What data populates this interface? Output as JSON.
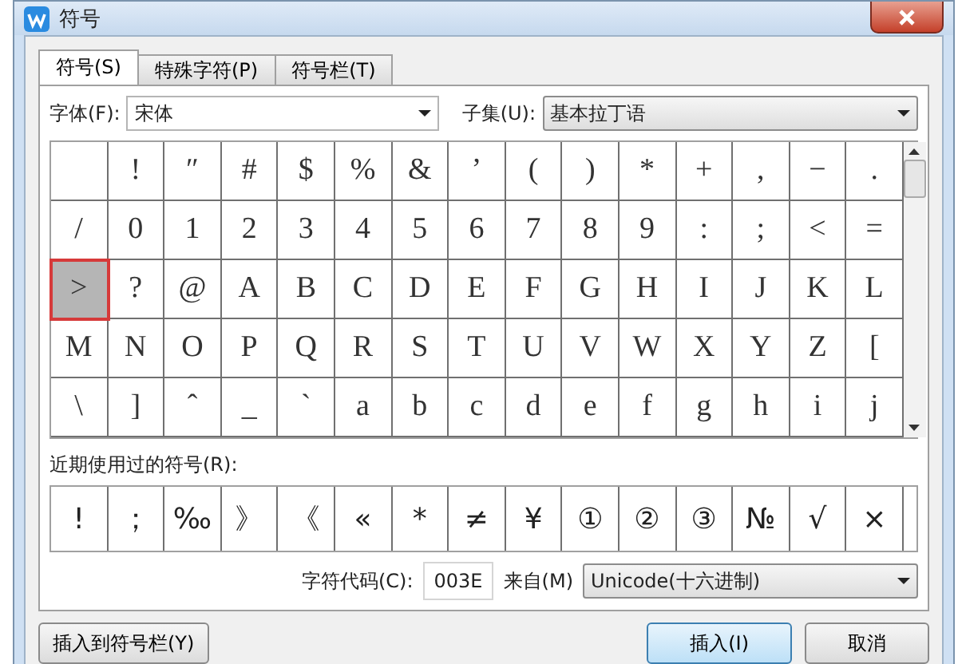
{
  "window": {
    "title": "符号"
  },
  "tabs": [
    {
      "label": "符号(S)",
      "selected": true
    },
    {
      "label": "特殊字符(P)",
      "selected": false
    },
    {
      "label": "符号栏(T)",
      "selected": false
    }
  ],
  "font": {
    "label": "字体(F):",
    "value": "宋体"
  },
  "subset": {
    "label": "子集(U):",
    "value": "基本拉丁语"
  },
  "grid": [
    [
      {
        "selected": false
      },
      {
        "char": "!",
        "selected": false
      },
      {
        "char": "″",
        "selected": false
      },
      {
        "char": "#",
        "selected": false
      },
      {
        "char": "$",
        "selected": false
      },
      {
        "char": "%",
        "selected": false
      },
      {
        "char": "&",
        "selected": false
      },
      {
        "char": "’",
        "selected": false
      },
      {
        "char": "(",
        "selected": false
      },
      {
        "char": ")",
        "selected": false
      },
      {
        "char": "*",
        "selected": false
      },
      {
        "char": "+",
        "selected": false
      },
      {
        "char": ",",
        "selected": false
      },
      {
        "char": "−",
        "selected": false
      },
      {
        "char": ".",
        "selected": false
      }
    ],
    [
      {
        "char": "/",
        "selected": false
      },
      {
        "char": "0",
        "selected": false
      },
      {
        "char": "1",
        "selected": false
      },
      {
        "char": "2",
        "selected": false
      },
      {
        "char": "3",
        "selected": false
      },
      {
        "char": "4",
        "selected": false
      },
      {
        "char": "5",
        "selected": false
      },
      {
        "char": "6",
        "selected": false
      },
      {
        "char": "7",
        "selected": false
      },
      {
        "char": "8",
        "selected": false
      },
      {
        "char": "9",
        "selected": false
      },
      {
        "char": ":",
        "selected": false
      },
      {
        "char": ";",
        "selected": false
      },
      {
        "char": "<",
        "selected": false
      },
      {
        "char": "=",
        "selected": false
      }
    ],
    [
      {
        "char": ">",
        "selected": true
      },
      {
        "char": "?",
        "selected": false
      },
      {
        "char": "@",
        "selected": false
      },
      {
        "char": "A",
        "selected": false
      },
      {
        "char": "B",
        "selected": false
      },
      {
        "char": "C",
        "selected": false
      },
      {
        "char": "D",
        "selected": false
      },
      {
        "char": "E",
        "selected": false
      },
      {
        "char": "F",
        "selected": false
      },
      {
        "char": "G",
        "selected": false
      },
      {
        "char": "H",
        "selected": false
      },
      {
        "char": "I",
        "selected": false
      },
      {
        "char": "J",
        "selected": false
      },
      {
        "char": "K",
        "selected": false
      },
      {
        "char": "L",
        "selected": false
      }
    ],
    [
      {
        "char": "M",
        "selected": false
      },
      {
        "char": "N",
        "selected": false
      },
      {
        "char": "O",
        "selected": false
      },
      {
        "char": "P",
        "selected": false
      },
      {
        "char": "Q",
        "selected": false
      },
      {
        "char": "R",
        "selected": false
      },
      {
        "char": "S",
        "selected": false
      },
      {
        "char": "T",
        "selected": false
      },
      {
        "char": "U",
        "selected": false
      },
      {
        "char": "V",
        "selected": false
      },
      {
        "char": "W",
        "selected": false
      },
      {
        "char": "X",
        "selected": false
      },
      {
        "char": "Y",
        "selected": false
      },
      {
        "char": "Z",
        "selected": false
      },
      {
        "char": "[",
        "selected": false
      }
    ],
    [
      {
        "char": "\\",
        "selected": false
      },
      {
        "char": "]",
        "selected": false
      },
      {
        "char": "ˆ",
        "selected": false
      },
      {
        "char": "_",
        "selected": false
      },
      {
        "char": "`",
        "selected": false
      },
      {
        "char": "a",
        "selected": false
      },
      {
        "char": "b",
        "selected": false
      },
      {
        "char": "c",
        "selected": false
      },
      {
        "char": "d",
        "selected": false
      },
      {
        "char": "e",
        "selected": false
      },
      {
        "char": "f",
        "selected": false
      },
      {
        "char": "g",
        "selected": false
      },
      {
        "char": "h",
        "selected": false
      },
      {
        "char": "i",
        "selected": false
      },
      {
        "char": "j",
        "selected": false
      }
    ]
  ],
  "recent": {
    "label": "近期使用过的符号(R):",
    "symbols": [
      "!",
      "；",
      "‰",
      "》",
      "《",
      "«",
      "*",
      "≠",
      "¥",
      "①",
      "②",
      "③",
      "№",
      "√",
      "×"
    ]
  },
  "code": {
    "label": "字符代码(C):",
    "value": "003E"
  },
  "from": {
    "label": "来自(M)",
    "value": "Unicode(十六进制)"
  },
  "buttons": [
    {
      "kind": "left",
      "label": "插入到符号栏(Y)"
    },
    {
      "kind": "primary",
      "label": "插入(I)"
    },
    {
      "kind": "normal",
      "label": "取消"
    }
  ]
}
